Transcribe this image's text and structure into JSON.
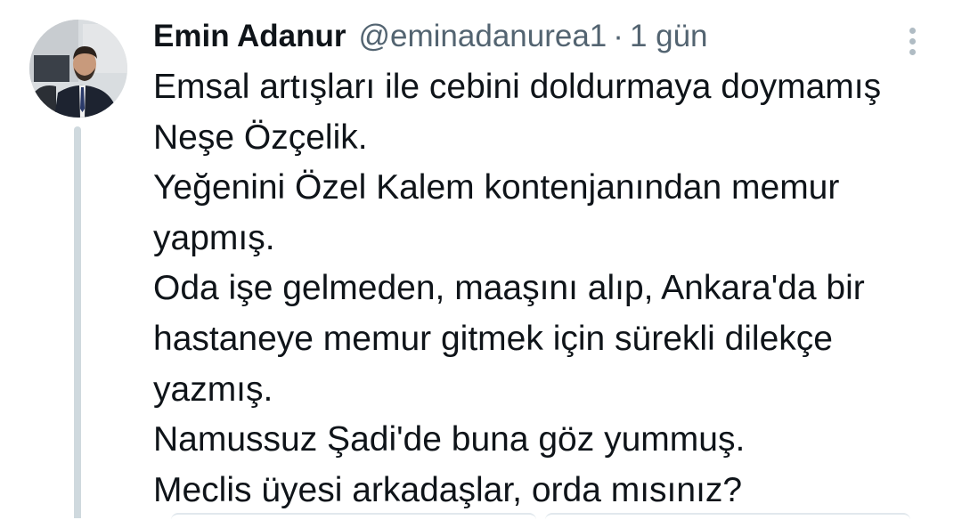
{
  "tweet": {
    "display_name": "Emin Adanur",
    "handle": "@eminadanurea1",
    "separator": "·",
    "time": "1 gün",
    "body_lines": [
      "Emsal artışları ile cebini doldurmaya doymamış",
      "Neşe Özçelik.",
      "Yeğenini Özel Kalem kontenjanından memur",
      "yapmış.",
      "Oda işe gelmeden, maaşını alıp, Ankara'da bir",
      "hastaneye memur gitmek için sürekli dilekçe",
      "yazmış.",
      "Namussuz Şadi'de buna göz yummuş.",
      "Meclis üyesi arkadaşlar, orda mısınız?"
    ],
    "more_icon": "more-vertical-icon",
    "colors": {
      "text": "#0f1419",
      "secondary": "#536471",
      "thread_line": "#cfd9de"
    }
  }
}
